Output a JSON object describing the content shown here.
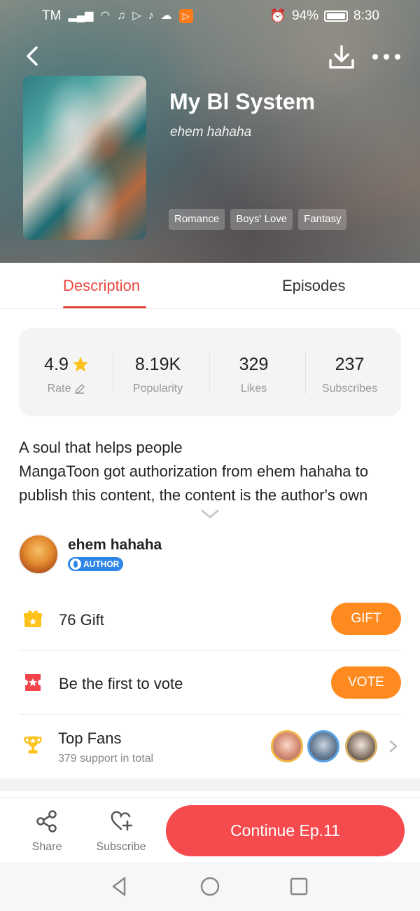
{
  "status_bar": {
    "carrier": "TM",
    "battery_percent": "94%",
    "time": "8:30"
  },
  "book": {
    "title": "My Bl System",
    "author": "ehem hahaha",
    "tags": [
      "Romance",
      "Boys' Love",
      "Fantasy"
    ]
  },
  "tabs": {
    "description": "Description",
    "episodes": "Episodes"
  },
  "stats": {
    "rate_value": "4.9",
    "rate_label": "Rate",
    "popularity_value": "8.19K",
    "popularity_label": "Popularity",
    "likes_value": "329",
    "likes_label": "Likes",
    "subscribes_value": "237",
    "subscribes_label": "Subscribes"
  },
  "description": {
    "line1": "A soul that helps people",
    "line2": "MangaToon got authorization from ehem hahaha to publish this content, the content is the author's own"
  },
  "author_section": {
    "name": "ehem hahaha",
    "badge": "AUTHOR"
  },
  "gift": {
    "label": "76  Gift",
    "button": "GIFT"
  },
  "vote": {
    "label": "Be the first to vote",
    "button": "VOTE"
  },
  "top_fans": {
    "title": "Top Fans",
    "subtitle": "379 support in total"
  },
  "bottom_bar": {
    "share": "Share",
    "subscribe": "Subscribe",
    "continue": "Continue Ep.11"
  },
  "colors": {
    "accent_red": "#e8483f",
    "orange": "#ff8a1f",
    "continue_red": "#f54a4e"
  }
}
